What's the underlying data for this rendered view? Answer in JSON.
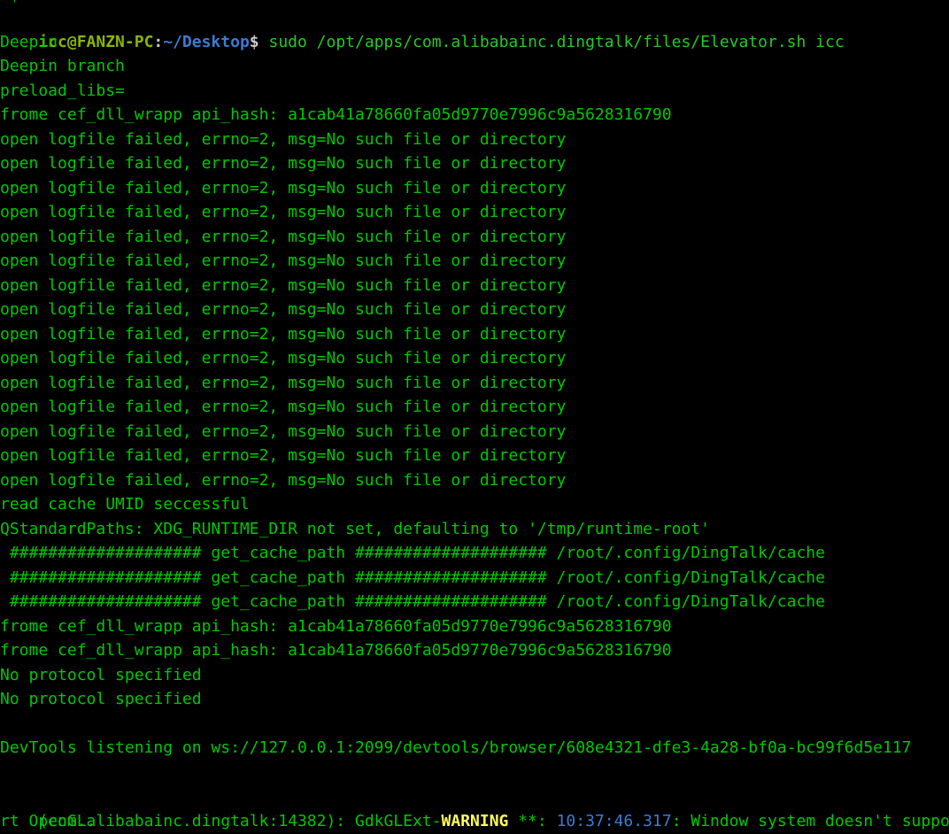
{
  "terminal": {
    "partial_top_line": "~$",
    "prompt": {
      "user_host": "icc@FANZN-PC",
      "colon": ":",
      "path": "~/Desktop",
      "dollar": "$",
      "command": " sudo /opt/apps/com.alibabainc.dingtalk/files/Elevator.sh icc"
    },
    "lines": [
      "Deepin",
      "Deepin branch",
      "preload_libs=",
      "frome cef_dll_wrapp api_hash: a1cab41a78660fa05d9770e7996c9a5628316790",
      "open logfile failed, errno=2, msg=No such file or directory",
      "open logfile failed, errno=2, msg=No such file or directory",
      "open logfile failed, errno=2, msg=No such file or directory",
      "open logfile failed, errno=2, msg=No such file or directory",
      "open logfile failed, errno=2, msg=No such file or directory",
      "open logfile failed, errno=2, msg=No such file or directory",
      "open logfile failed, errno=2, msg=No such file or directory",
      "open logfile failed, errno=2, msg=No such file or directory",
      "open logfile failed, errno=2, msg=No such file or directory",
      "open logfile failed, errno=2, msg=No such file or directory",
      "open logfile failed, errno=2, msg=No such file or directory",
      "open logfile failed, errno=2, msg=No such file or directory",
      "open logfile failed, errno=2, msg=No such file or directory",
      "open logfile failed, errno=2, msg=No such file or directory",
      "open logfile failed, errno=2, msg=No such file or directory",
      "read cache UMID seccessful",
      "QStandardPaths: XDG_RUNTIME_DIR not set, defaulting to '/tmp/runtime-root'",
      " #################### get_cache_path #################### /root/.config/DingTalk/cache",
      " #################### get_cache_path #################### /root/.config/DingTalk/cache",
      " #################### get_cache_path #################### /root/.config/DingTalk/cache",
      "frome cef_dll_wrapp api_hash: a1cab41a78660fa05d9770e7996c9a5628316790",
      "frome cef_dll_wrapp api_hash: a1cab41a78660fa05d9770e7996c9a5628316790",
      "No protocol specified",
      "No protocol specified",
      "",
      "DevTools listening on ws://127.0.0.1:2099/devtools/browser/608e4321-dfe3-4a28-bf0a-bc99f6d5e117",
      ""
    ],
    "warning_line": {
      "prefix": "(com.alibabainc.dingtalk:14382): GdkGLExt-",
      "level": "WARNING",
      "stars": " **: ",
      "timestamp": "10:37:46.317",
      "message": ": Window system doesn't suppo"
    },
    "last_line": "rt OpenGL."
  }
}
